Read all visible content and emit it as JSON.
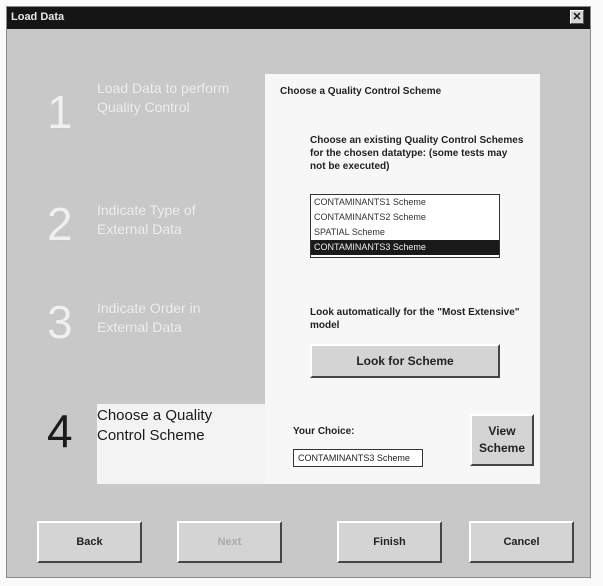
{
  "window": {
    "title": "Load Data",
    "close_glyph": "✕"
  },
  "steps": [
    {
      "number": "1",
      "label": "Load Data to perform Quality Control"
    },
    {
      "number": "2",
      "label": "Indicate Type of External Data"
    },
    {
      "number": "3",
      "label": "Indicate Order in External Data"
    },
    {
      "number": "4",
      "label": "Choose a Quality Control Scheme"
    }
  ],
  "panel": {
    "title": "Choose a Quality Control Scheme",
    "description": "Choose an existing Quality Control Schemes for the chosen datatype: (some tests may not be executed)",
    "schemes": [
      "CONTAMINANTS1 Scheme",
      "CONTAMINANTS2 Scheme",
      "SPATIAL Scheme",
      "CONTAMINANTS3 Scheme"
    ],
    "selected_index": 3,
    "look_text": "Look automatically for the \"Most Extensive\" model",
    "look_button": "Look for Scheme",
    "choice_label": "Your Choice:",
    "choice_value": "CONTAMINANTS3 Scheme",
    "view_button": "View Scheme"
  },
  "buttons": {
    "back": "Back",
    "next": "Next",
    "finish": "Finish",
    "cancel": "Cancel"
  }
}
